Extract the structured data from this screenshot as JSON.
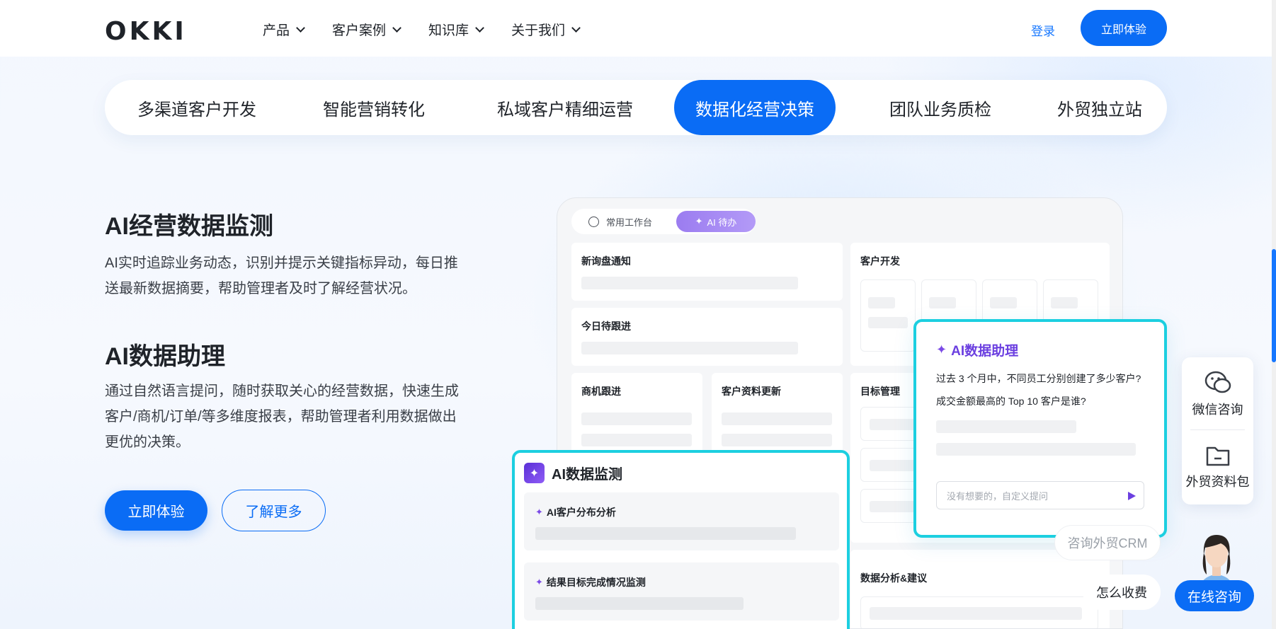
{
  "header": {
    "logo": "OKKI",
    "nav": [
      {
        "label": "产品"
      },
      {
        "label": "客户案例"
      },
      {
        "label": "知识库"
      },
      {
        "label": "关于我们"
      }
    ],
    "login": "登录",
    "cta": "立即体验"
  },
  "tabs": [
    {
      "label": "多渠道客户开发",
      "active": false
    },
    {
      "label": "智能营销转化",
      "active": false
    },
    {
      "label": "私域客户精细运营",
      "active": false
    },
    {
      "label": "数据化经营决策",
      "active": true
    },
    {
      "label": "团队业务质检",
      "active": false
    },
    {
      "label": "外贸独立站",
      "active": false
    }
  ],
  "features": [
    {
      "title": "AI经营数据监测",
      "desc": "AI实时追踪业务动态，识别并提示关键指标异动，每日推送最新数据摘要，帮助管理者及时了解经营状况。"
    },
    {
      "title": "AI数据助理",
      "desc": "通过自然语言提问，随时获取关心的经营数据，快速生成客户/商机/订单/等多维度报表，帮助管理者利用数据做出更优的决策。"
    }
  ],
  "buttons": {
    "primary": "立即体验",
    "secondary": "了解更多"
  },
  "dashboard": {
    "tab_common": "常用工作台",
    "tab_ai": "AI 待办",
    "cards": {
      "new_inquiry": "新询盘通知",
      "today_followup": "今日待跟进",
      "opportunity": "商机跟进",
      "customer_update": "客户资料更新",
      "customer_dev": "客户开发",
      "goal_mgmt": "目标管理",
      "data_analysis": "数据分析&建议"
    }
  },
  "assistant": {
    "title": "AI数据助理",
    "q1": "过去 3 个月中，不同员工分别创建了多少客户?",
    "q2": "成交金额最高的 Top 10 客户是谁?",
    "input_placeholder": "没有想要的，自定义提问"
  },
  "monitor": {
    "title": "AI数据监测",
    "item1": "AI客户分布分析",
    "item2": "结果目标完成情况监测"
  },
  "side": {
    "wechat": "微信咨询",
    "pack": "外贸资料包",
    "consult_crm": "咨询外贸CRM",
    "pricing": "怎么收费",
    "online": "在线咨询"
  },
  "colors": {
    "accent": "#0a6cf5",
    "ai_purple": "#6b3fe0",
    "cyan_border": "#1ccfe0"
  }
}
